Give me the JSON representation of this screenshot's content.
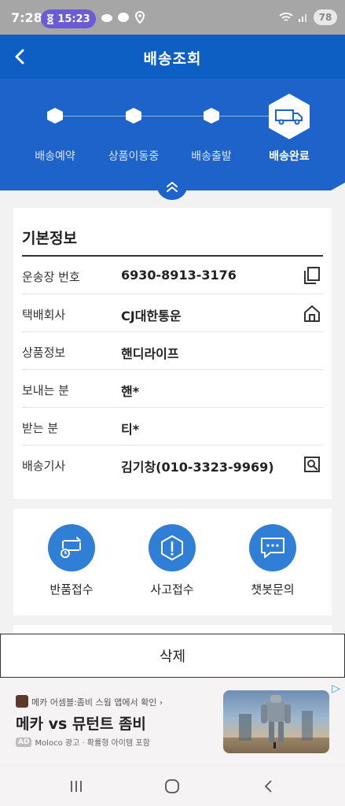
{
  "status_bar": {
    "time": "7:28",
    "timer": "15:23",
    "battery": "78"
  },
  "header": {
    "title": "배송조회"
  },
  "progress": {
    "steps": [
      {
        "label": "배송예약",
        "active": false
      },
      {
        "label": "상품이동중",
        "active": false
      },
      {
        "label": "배송출발",
        "active": false
      },
      {
        "label": "배송완료",
        "active": true
      }
    ],
    "accent_color": "#1e63c9"
  },
  "basic_info": {
    "title": "기본정보",
    "rows": [
      {
        "label": "운송장 번호",
        "value": "6930-8913-3176",
        "icon": "copy-icon"
      },
      {
        "label": "택배회사",
        "value": "CJ대한통운",
        "icon": "home-icon"
      },
      {
        "label": "상품정보",
        "value": "핸디라이프",
        "icon": ""
      },
      {
        "label": "보내는 분",
        "value": "핸*",
        "icon": ""
      },
      {
        "label": "받는 분",
        "value": "티*",
        "icon": ""
      },
      {
        "label": "배송기사",
        "value": "김기창(010-3323-9969)",
        "icon": "contact-search-icon"
      }
    ]
  },
  "actions": [
    {
      "label": "반품접수",
      "icon": "return-icon"
    },
    {
      "label": "사고접수",
      "icon": "alert-hexagon-icon"
    },
    {
      "label": "챗봇문의",
      "icon": "chat-bubble-icon"
    }
  ],
  "delete_label": "삭제",
  "ad": {
    "app_line": "메카 어셈블:좀비 스웜 앱에서 확인 ›",
    "title": "메카 vs 뮤턴트 좀비",
    "tag": "AD",
    "meta": "Moloco 광고 · 확률형 아이템 포함"
  }
}
